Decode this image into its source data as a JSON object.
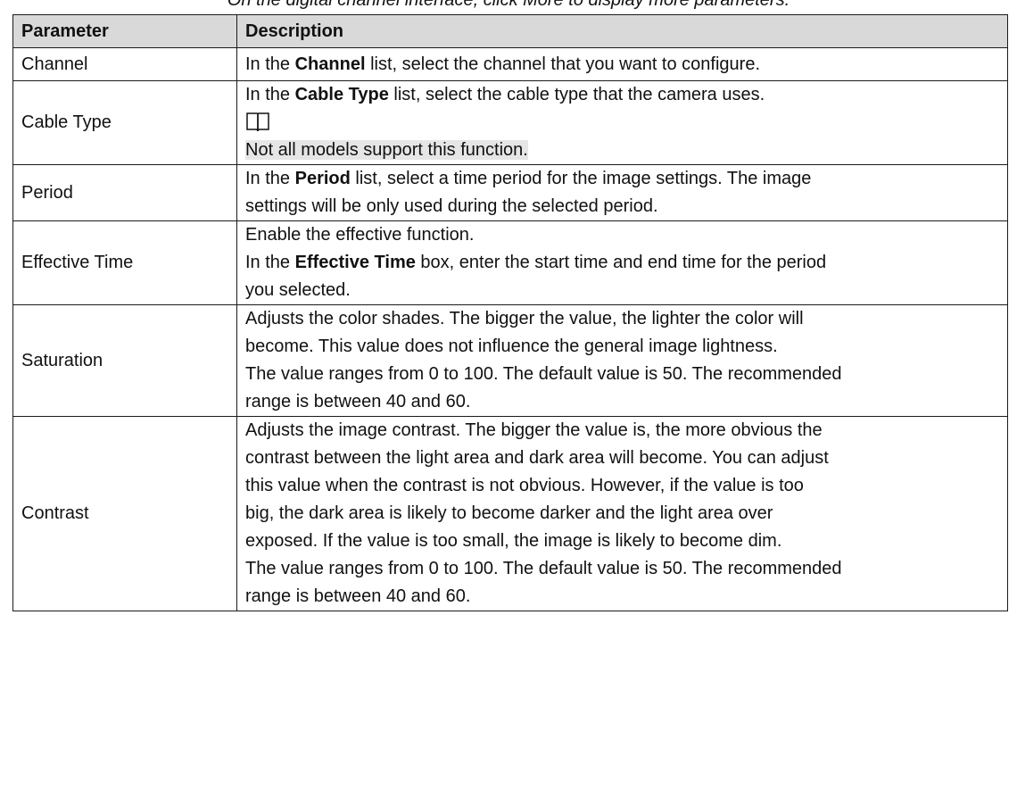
{
  "intro_text": "On the digital channel interface, click More to display more parameters.",
  "table": {
    "header": {
      "parameter": "Parameter",
      "description": "Description"
    },
    "rows": [
      {
        "name": "Channel",
        "lines": [
          {
            "pre": "In the ",
            "bold": "Channel",
            "post": " list, select the channel that you want to configure."
          }
        ]
      },
      {
        "name": "Cable Type",
        "lines": [
          {
            "pre": "In the ",
            "bold": "Cable Type",
            "post": " list, select the cable type that the camera uses."
          }
        ],
        "note_icon": "book-note-icon",
        "note": "Not all models support this function."
      },
      {
        "name": "Period",
        "lines": [
          {
            "pre": "In the ",
            "bold": "Period",
            "post": " list, select a time period for the image settings. The image"
          },
          {
            "pre": "settings will be only used during the selected period.",
            "bold": "",
            "post": ""
          }
        ]
      },
      {
        "name": "Effective Time",
        "lines": [
          {
            "pre": "Enable the effective function.",
            "bold": "",
            "post": ""
          },
          {
            "pre": "In the ",
            "bold": "Effective Time",
            "post": " box, enter the start time and end time for the period"
          },
          {
            "pre": "you selected.",
            "bold": "",
            "post": ""
          }
        ]
      },
      {
        "name": "Saturation",
        "lines": [
          {
            "pre": "Adjusts the color shades. The bigger the value, the lighter the color will",
            "bold": "",
            "post": ""
          },
          {
            "pre": "become. This value does not influence the general image lightness.",
            "bold": "",
            "post": ""
          },
          {
            "pre": "The value ranges from 0 to 100. The default value is 50. The recommended",
            "bold": "",
            "post": ""
          },
          {
            "pre": "range is between 40 and 60.",
            "bold": "",
            "post": ""
          }
        ]
      },
      {
        "name": "Contrast",
        "lines": [
          {
            "pre": "Adjusts the image contrast. The bigger the value is, the more obvious the",
            "bold": "",
            "post": ""
          },
          {
            "pre": "contrast between the light area and dark area will become. You can adjust",
            "bold": "",
            "post": ""
          },
          {
            "pre": "this value when the contrast is not obvious. However, if the value is too",
            "bold": "",
            "post": ""
          },
          {
            "pre": "big, the dark area is likely to become darker and the light area over",
            "bold": "",
            "post": ""
          },
          {
            "pre": "exposed. If the value is too small, the image is likely to become dim.",
            "bold": "",
            "post": ""
          },
          {
            "pre": "The value ranges from 0 to 100. The default value is 50. The recommended",
            "bold": "",
            "post": ""
          },
          {
            "pre": "range is between 40 and 60.",
            "bold": "",
            "post": ""
          }
        ]
      }
    ]
  },
  "colors": {
    "header_bg": "#d9d9d9",
    "note_highlight": "#e6e6e6",
    "border": "#1a1a1a"
  }
}
